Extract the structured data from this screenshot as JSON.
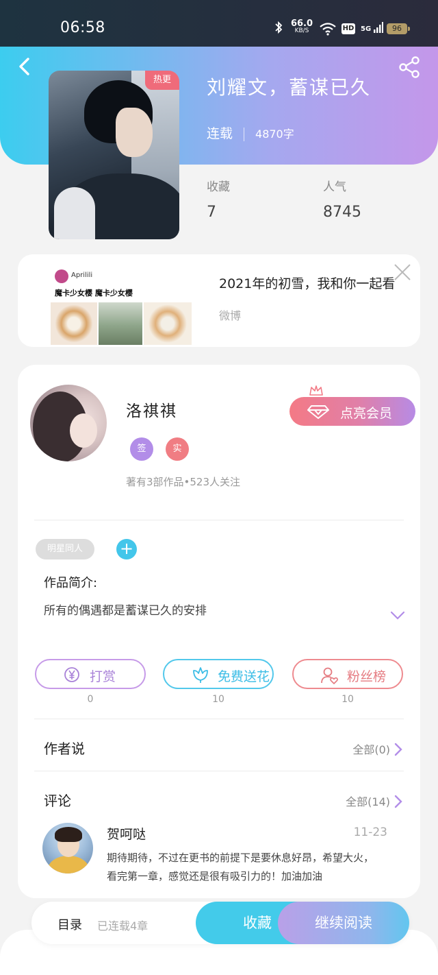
{
  "status_bar": {
    "time": "06:58",
    "net_speed_value": "66.0",
    "net_speed_unit": "KB/S",
    "hd_label": "HD",
    "network_label": "5G",
    "battery": "96",
    "icons": [
      "bluetooth-icon",
      "wifi-icon",
      "signal-icon",
      "battery-icon"
    ]
  },
  "header": {
    "back_icon": "chevron-left-icon",
    "share_icon": "share-icon",
    "hot_badge": "热更",
    "title": "刘耀文，蓄谋已久",
    "status": "连载",
    "word_count": "4870字",
    "stats": [
      {
        "label": "收藏",
        "value": "7"
      },
      {
        "label": "人气",
        "value": "8745"
      }
    ]
  },
  "ad": {
    "thumb_user": "Aprilili",
    "thumb_caption": "魔卡少女樱  魔卡少女樱",
    "title": "2021年的初雪，我和你一起看",
    "source": "微博",
    "close_icon": "close-icon"
  },
  "author": {
    "name": "洛祺祺",
    "tags": [
      "签",
      "实"
    ],
    "meta": "著有3部作品•523人关注",
    "vip_button": "点亮会员"
  },
  "book_info": {
    "genre_tag": "明星同人",
    "add_tag": "+",
    "intro_label": "作品简介:",
    "intro_text": "所有的偶遇都是蓄谋已久的安排"
  },
  "actions": [
    {
      "label": "打赏",
      "count": "0",
      "icon": "yen-icon",
      "color": "#a982d8"
    },
    {
      "label": "免费送花",
      "count": "10",
      "icon": "flower-icon",
      "color": "#3cbde6"
    },
    {
      "label": "粉丝榜",
      "count": "10",
      "icon": "user-heart-icon",
      "color": "#e57b81"
    }
  ],
  "author_notes": {
    "title": "作者说",
    "more": "全部(0)"
  },
  "comments": {
    "title": "评论",
    "more": "全部(14)",
    "items": [
      {
        "user": "贺呵哒",
        "date": "11-23",
        "text": "期待期待，不过在更书的前提下是要休息好昂，希望大火，看完第一章，感觉还是很有吸引力的！加油加油"
      }
    ]
  },
  "bottom_bar": {
    "toc_label": "目录",
    "toc_count": "已连载4章",
    "favorite_button": "收藏",
    "continue_button": "继续阅读"
  }
}
